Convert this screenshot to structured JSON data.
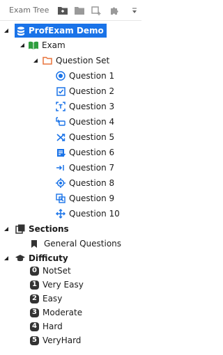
{
  "panel": {
    "title": "Exam Tree"
  },
  "toolbar": {
    "buttons": [
      {
        "icon": "add-folder-icon"
      },
      {
        "icon": "folder-icon"
      },
      {
        "icon": "add-item-icon"
      },
      {
        "icon": "puzzle-icon"
      }
    ],
    "menu_icon": "dropdown-menu-icon"
  },
  "tree": {
    "root": {
      "label": "ProfExam Demo",
      "icon": "database-icon",
      "selected": true
    },
    "exam": {
      "label": "Exam",
      "icon": "open-book-icon"
    },
    "question_set": {
      "label": "Question Set",
      "icon": "folder-outline-icon"
    },
    "questions": [
      {
        "label": "Question 1",
        "icon": "radio-button-icon"
      },
      {
        "label": "Question 2",
        "icon": "checkbox-icon"
      },
      {
        "label": "Question 3",
        "icon": "text-field-icon"
      },
      {
        "label": "Question 4",
        "icon": "sort-order-icon"
      },
      {
        "label": "Question 5",
        "icon": "shuffle-match-icon"
      },
      {
        "label": "Question 6",
        "icon": "essay-icon"
      },
      {
        "label": "Question 7",
        "icon": "drag-insert-icon"
      },
      {
        "label": "Question 8",
        "icon": "hotspot-target-icon"
      },
      {
        "label": "Question 9",
        "icon": "drag-drop-icon"
      },
      {
        "label": "Question 10",
        "icon": "move-arrows-icon"
      }
    ],
    "sections": {
      "label": "Sections",
      "icon": "sections-icon"
    },
    "general_questions": {
      "label": "General Questions",
      "icon": "bookmark-icon"
    },
    "difficulty": {
      "label": "Difficuty",
      "icon": "graduation-cap-icon"
    },
    "levels": [
      {
        "num": "0",
        "label": "NotSet"
      },
      {
        "num": "1",
        "label": "Very Easy"
      },
      {
        "num": "2",
        "label": "Easy"
      },
      {
        "num": "3",
        "label": "Moderate"
      },
      {
        "num": "4",
        "label": "Hard"
      },
      {
        "num": "5",
        "label": "VeryHard"
      }
    ]
  },
  "colors": {
    "accent": "#1a73e8",
    "folder": "#e8743b",
    "book": "#2e9e3e",
    "dark": "#333333"
  }
}
